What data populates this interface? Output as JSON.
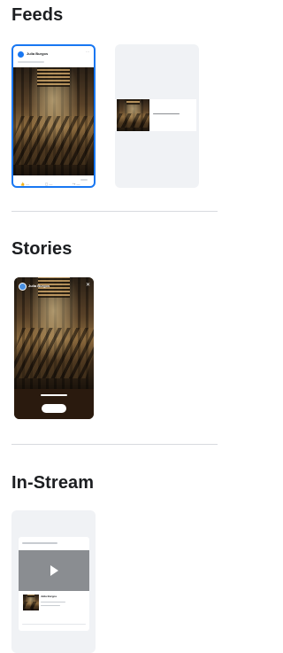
{
  "sections": {
    "feeds": {
      "title": "Feeds"
    },
    "stories": {
      "title": "Stories"
    },
    "instream": {
      "title": "In-Stream"
    }
  },
  "preview": {
    "page_name": "Julia Burgos"
  },
  "instream_preview": {
    "page_name": "Julia Burgos"
  },
  "colors": {
    "accent": "#1877f2",
    "card_bg": "#f0f2f5",
    "divider": "#d8dadf"
  },
  "icons": [
    "play-icon",
    "close-icon",
    "like-icon",
    "comment-icon",
    "share-icon",
    "more-icon"
  ]
}
